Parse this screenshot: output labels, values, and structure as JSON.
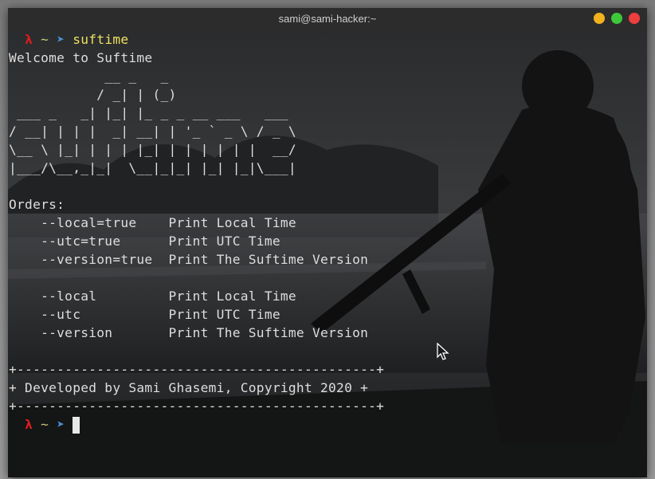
{
  "window": {
    "title": "sami@sami-hacker:~"
  },
  "prompt": {
    "lambda": "λ",
    "tilde": "~",
    "arrow": "➤"
  },
  "terminal": {
    "command": "suftime",
    "welcome": "Welcome to Suftime",
    "ascii_art": [
      "            __ _   _",
      "           / _| | (_)",
      " ___ _   _| |_| |_ _ _ __ ___   ___",
      "/ __| | | |  _| __| | '_ ` _ \\ / _ \\",
      "\\__ \\ |_| | | | |_| | | | | | |  __/",
      "|___/\\__,_|_|  \\__|_|_| |_| |_|\\___|"
    ],
    "orders_heading": "Orders:",
    "orders_group1": [
      {
        "flag": "    --local=true    ",
        "desc": "Print Local Time"
      },
      {
        "flag": "    --utc=true      ",
        "desc": "Print UTC Time"
      },
      {
        "flag": "    --version=true  ",
        "desc": "Print The Suftime Version"
      }
    ],
    "orders_group2": [
      {
        "flag": "    --local         ",
        "desc": "Print Local Time"
      },
      {
        "flag": "    --utc           ",
        "desc": "Print UTC Time"
      },
      {
        "flag": "    --version       ",
        "desc": "Print The Suftime Version"
      }
    ],
    "border_line": "+---------------------------------------------+",
    "credit_line": "+ Developed by Sami Ghasemi, Copyright 2020 +"
  },
  "colors": {
    "prompt_lambda": "#e31c1c",
    "prompt_arrow": "#4a90d0",
    "command": "#f0e060",
    "text": "#dedede"
  }
}
